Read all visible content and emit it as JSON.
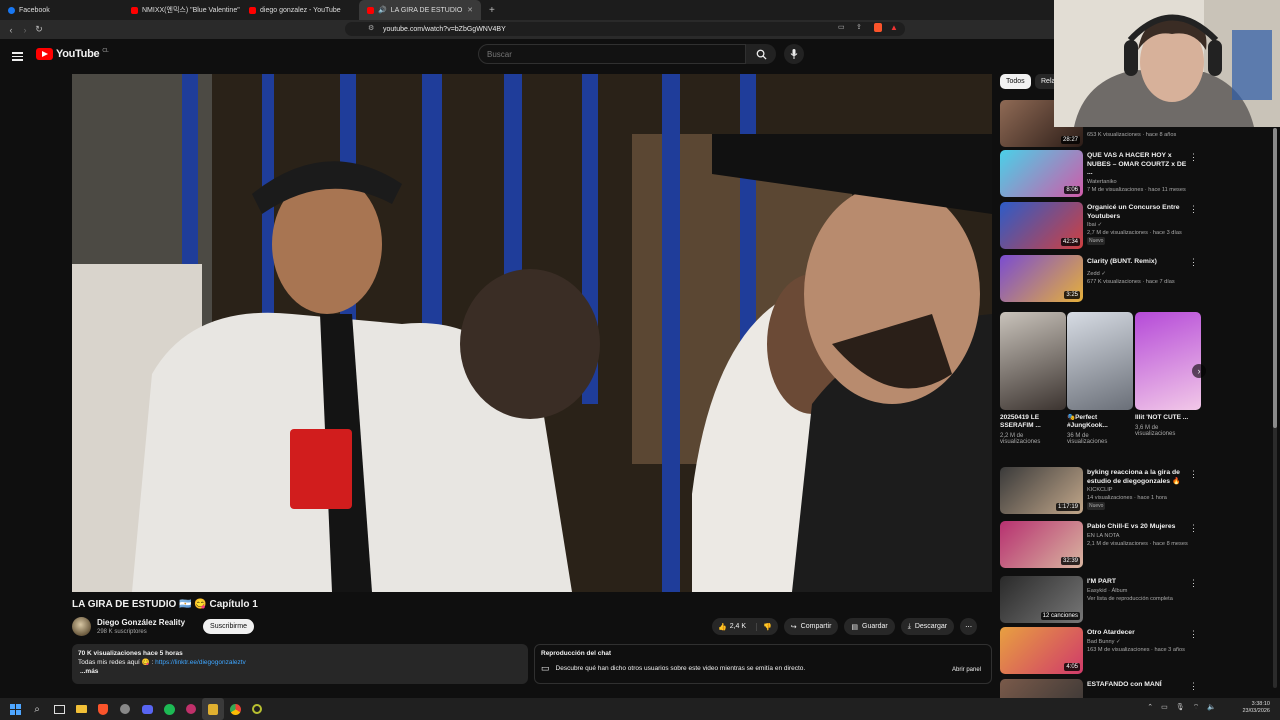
{
  "browser": {
    "tabs": [
      {
        "label": "Facebook",
        "color": "#1877f2"
      },
      {
        "label": "NMIXX(엔믹스) \"Blue Valentine\" M/V",
        "color": "#ff0000"
      },
      {
        "label": "diego gonzalez - YouTube",
        "color": "#ff0000"
      },
      {
        "label": "LA GIRA DE ESTUDIO 🇦🇷 😋 C",
        "color": "#ff0000"
      }
    ],
    "new_tab": "+",
    "url": "youtube.com/watch?v=bZbGgWNV4BY"
  },
  "youtube": {
    "logo_text": "YouTube",
    "country": "CL",
    "search_placeholder": "Buscar"
  },
  "video": {
    "title": "LA GIRA DE ESTUDIO 🇦🇷 😋 Capítulo 1",
    "channel": "Diego González Reality",
    "subscribers": "298 K suscriptores",
    "subscribe_label": "Suscribirme",
    "likes": "2,4 K",
    "share": "Compartir",
    "save": "Guardar",
    "download": "Descargar",
    "description": {
      "stats": "70 K visualizaciones  hace 5 horas",
      "line": "Todas mis redes aquí 😋 : ",
      "link": "https://linktr.ee/diegogonzaleztv",
      "more": "...más"
    },
    "chat": {
      "title": "Reproducción del chat",
      "text": "Descubre qué han dicho otros usuarios sobre este video mientras se emitía en directo.",
      "button": "Abrir panel"
    }
  },
  "chips": [
    "Todos",
    "Rela"
  ],
  "recommendations": [
    {
      "title": "",
      "channel": "",
      "meta": "653 K visualizaciones · hace 8 años",
      "duration": "28:27",
      "new": false,
      "verified": false
    },
    {
      "title": "QUE VAS A HACER HOY x NUBES – OMAR COURTZ x DE ...",
      "channel": "Watertaniko",
      "meta": "7 M de visualizaciones · hace 11 meses",
      "duration": "8:06",
      "new": false,
      "verified": false
    },
    {
      "title": "Organicé un Concurso Entre Youtubers",
      "channel": "Ibai",
      "meta": "2,7 M de visualizaciones · hace 3 días",
      "duration": "42:34",
      "new": true,
      "verified": true
    },
    {
      "title": "Clarity (BUNT. Remix)",
      "channel": "Zedd",
      "meta": "677 K visualizaciones · hace 7 días",
      "duration": "3:25",
      "new": false,
      "verified": true
    },
    {
      "title": "byking reacciona a la gira de estudio de diegogonzales 🔥",
      "channel": "KICKCLIP",
      "meta": "14 visualizaciones · hace 1 hora",
      "duration": "1:17:19",
      "new": true,
      "verified": false
    },
    {
      "title": "Pablo Chill-E vs 20 Mujeres",
      "channel": "EN LA NOTA",
      "meta": "2,1 M de visualizaciones · hace 8 meses",
      "duration": "32:39",
      "new": false,
      "verified": false
    },
    {
      "title": "I'M PART",
      "channel": "Easykid · Álbum",
      "meta": "Ver lista de reproducción completa",
      "duration": "12 canciones",
      "new": false,
      "verified": false
    },
    {
      "title": "Otro Atardecer",
      "channel": "Bad Bunny",
      "meta": "163 M de visualizaciones · hace 3 años",
      "duration": "4:05",
      "new": false,
      "verified": true
    },
    {
      "title": "ESTAFANDO con MANÍ",
      "channel": "",
      "meta": "",
      "duration": "",
      "new": false,
      "verified": false
    }
  ],
  "new_label": "Nuevo",
  "shorts": [
    {
      "title": "20250419 LE SSERAFIM ...",
      "views": "2,2 M de visualizaciones"
    },
    {
      "title": "🎭Perfect #JungKook...",
      "views": "36 M de visualizaciones"
    },
    {
      "title": "Illit 'NOT CUTE ...",
      "views": "3,6 M de visualizaciones"
    }
  ],
  "taskbar": {
    "time": "3:38:10",
    "date": "23/03/2026"
  }
}
